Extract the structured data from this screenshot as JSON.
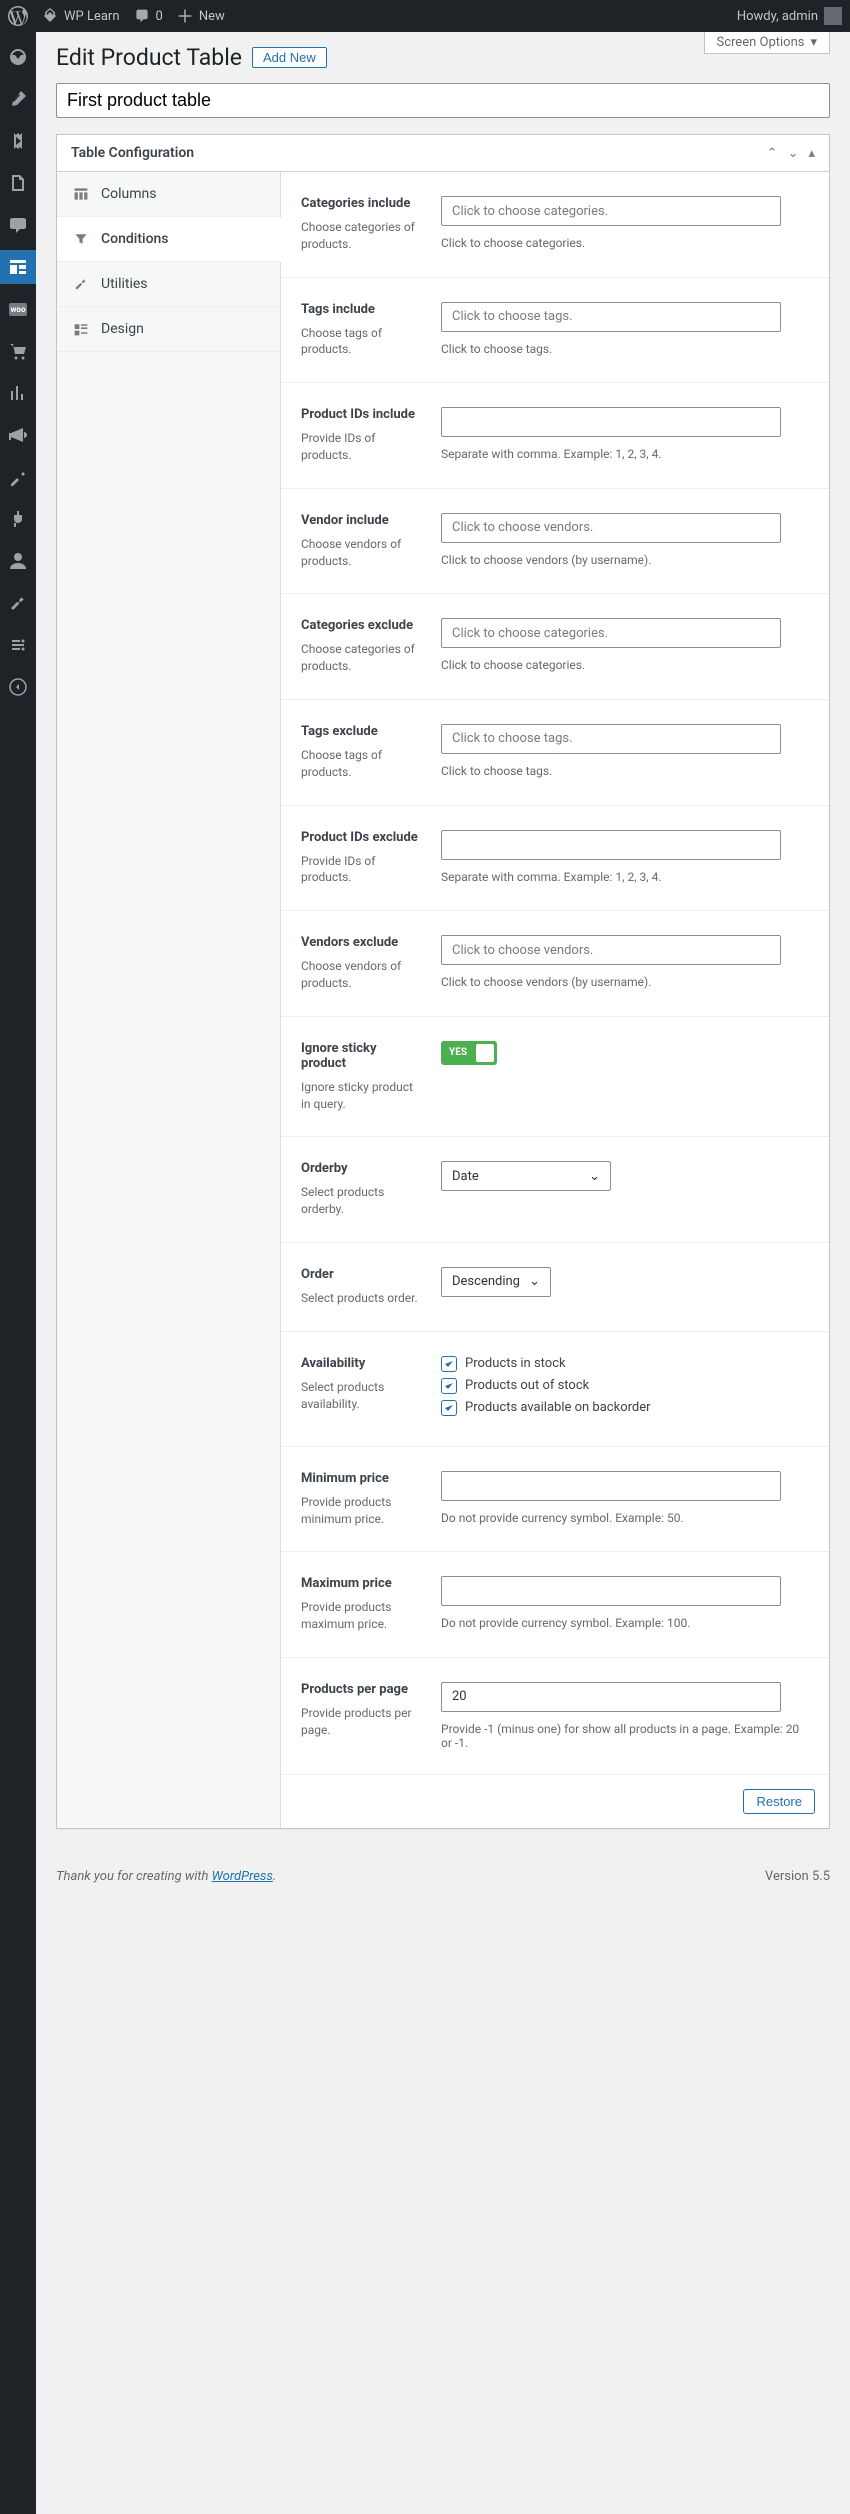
{
  "adminbar": {
    "site_name": "WP Learn",
    "comments": "0",
    "new": "New",
    "howdy": "Howdy, admin"
  },
  "screen_options": "Screen Options",
  "page": {
    "heading": "Edit Product Table",
    "add_new": "Add New",
    "title_value": "First product table"
  },
  "postbox": {
    "title": "Table Configuration"
  },
  "tabs": {
    "columns": "Columns",
    "conditions": "Conditions",
    "utilities": "Utilities",
    "design": "Design"
  },
  "fields": {
    "cat_inc": {
      "label": "Categories include",
      "desc": "Choose categories of products.",
      "ph": "Click to choose categories.",
      "hint": "Click to choose categories."
    },
    "tag_inc": {
      "label": "Tags include",
      "desc": "Choose tags of products.",
      "ph": "Click to choose tags.",
      "hint": "Click to choose tags."
    },
    "pid_inc": {
      "label": "Product IDs include",
      "desc": "Provide IDs of products.",
      "hint": "Separate with comma. Example: 1, 2, 3, 4."
    },
    "ven_inc": {
      "label": "Vendor include",
      "desc": "Choose vendors of products.",
      "ph": "Click to choose vendors.",
      "hint": "Click to choose vendors (by username)."
    },
    "cat_exc": {
      "label": "Categories exclude",
      "desc": "Choose categories of products.",
      "ph": "Click to choose categories.",
      "hint": "Click to choose categories."
    },
    "tag_exc": {
      "label": "Tags exclude",
      "desc": "Choose tags of products.",
      "ph": "Click to choose tags.",
      "hint": "Click to choose tags."
    },
    "pid_exc": {
      "label": "Product IDs exclude",
      "desc": "Provide IDs of products.",
      "hint": "Separate with comma. Example: 1, 2, 3, 4."
    },
    "ven_exc": {
      "label": "Vendors exclude",
      "desc": "Choose vendors of products.",
      "ph": "Click to choose vendors.",
      "hint": "Click to choose vendors (by username)."
    },
    "sticky": {
      "label": "Ignore sticky product",
      "desc": "Ignore sticky product in query.",
      "val": "YES"
    },
    "orderby": {
      "label": "Orderby",
      "desc": "Select products orderby.",
      "val": "Date"
    },
    "order": {
      "label": "Order",
      "desc": "Select products order.",
      "val": "Descending"
    },
    "avail": {
      "label": "Availability",
      "desc": "Select products availability.",
      "o1": "Products in stock",
      "o2": "Products out of stock",
      "o3": "Products available on backorder"
    },
    "min": {
      "label": "Minimum price",
      "desc": "Provide products minimum price.",
      "hint": "Do not provide currency symbol. Example: 50."
    },
    "max": {
      "label": "Maximum price",
      "desc": "Provide products maximum price.",
      "hint": "Do not provide currency symbol. Example: 100."
    },
    "ppp": {
      "label": "Products per page",
      "desc": "Provide products per page.",
      "val": "20",
      "hint": "Provide -1 (minus one) for show all products in a page. Example: 20 or -1."
    }
  },
  "restore": "Restore",
  "footer": {
    "text": "Thank you for creating with ",
    "link": "WordPress",
    "suffix": ".",
    "version": "Version 5.5"
  }
}
